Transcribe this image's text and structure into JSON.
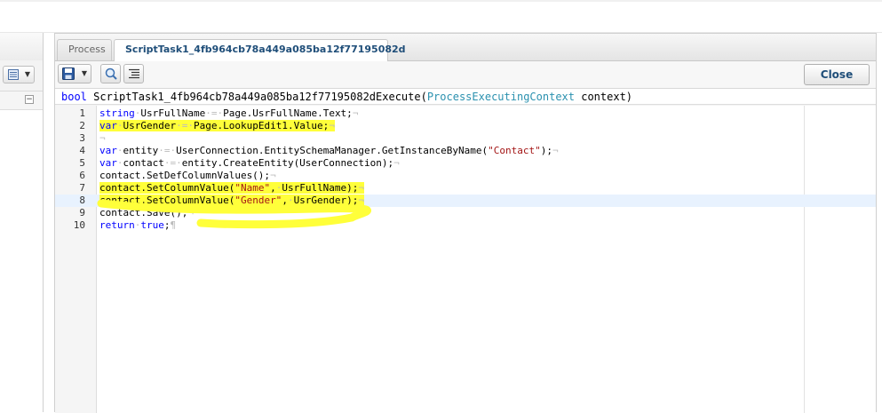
{
  "tabs": [
    {
      "label": "Process",
      "active": false
    },
    {
      "label": "ScriptTask1_4fb964cb78a449a085ba12f77195082d",
      "active": true
    }
  ],
  "toolbar": {
    "close_label": "Close",
    "icons": [
      "save-icon",
      "search-icon",
      "format-code-icon"
    ]
  },
  "signature": {
    "return_type": "bool",
    "method": "ScriptTask1_4fb964cb78a449a085ba12f77195082dExecute(",
    "param_type": "ProcessExecutingContext",
    "param_rest": " context)"
  },
  "editor": {
    "current_line": 8,
    "highlight_color": "#ffff3a",
    "line_numbers": [
      "1",
      "2",
      "3",
      "4",
      "5",
      "6",
      "7",
      "8",
      "9",
      "10"
    ],
    "lines": [
      [
        {
          "t": "string",
          "c": "kw"
        },
        {
          "t": "·",
          "c": "ws"
        },
        {
          "t": "UsrFullName"
        },
        {
          "t": "·=·",
          "c": "ws"
        },
        {
          "t": "Page.UsrFullName.Text;"
        },
        {
          "t": "¬",
          "c": "ws"
        }
      ],
      [
        {
          "t": "var",
          "c": "kw"
        },
        {
          "t": "·",
          "c": "ws"
        },
        {
          "t": "UsrGender"
        },
        {
          "t": "·=·",
          "c": "ws"
        },
        {
          "t": "Page.LookupEdit1.Value;"
        },
        {
          "t": "¬",
          "c": "ws"
        }
      ],
      [
        {
          "t": "¬",
          "c": "ws"
        }
      ],
      [
        {
          "t": "var",
          "c": "kw"
        },
        {
          "t": "·",
          "c": "ws"
        },
        {
          "t": "entity"
        },
        {
          "t": "·=·",
          "c": "ws"
        },
        {
          "t": "UserConnection.EntitySchemaManager.GetInstanceByName("
        },
        {
          "t": "\"Contact\"",
          "c": "str"
        },
        {
          "t": ");"
        },
        {
          "t": "¬",
          "c": "ws"
        }
      ],
      [
        {
          "t": "var",
          "c": "kw"
        },
        {
          "t": "·",
          "c": "ws"
        },
        {
          "t": "contact"
        },
        {
          "t": "·=·",
          "c": "ws"
        },
        {
          "t": "entity.CreateEntity(UserConnection);"
        },
        {
          "t": "¬",
          "c": "ws"
        }
      ],
      [
        {
          "t": "contact.SetDefColumnValues();"
        },
        {
          "t": "¬",
          "c": "ws"
        }
      ],
      [
        {
          "t": "contact.SetColumnValue("
        },
        {
          "t": "\"Name\"",
          "c": "str"
        },
        {
          "t": ","
        },
        {
          "t": "·",
          "c": "ws"
        },
        {
          "t": "UsrFullName);"
        },
        {
          "t": "¬",
          "c": "ws"
        }
      ],
      [
        {
          "t": "contact.SetColumnValue("
        },
        {
          "t": "\"Gender\"",
          "c": "str"
        },
        {
          "t": ","
        },
        {
          "t": "·",
          "c": "ws"
        },
        {
          "t": "UsrGender);"
        },
        {
          "t": "¬",
          "c": "ws"
        }
      ],
      [
        {
          "t": "contact.Save();"
        },
        {
          "t": "¬",
          "c": "ws"
        }
      ],
      [
        {
          "t": "return",
          "c": "kw"
        },
        {
          "t": "·",
          "c": "ws"
        },
        {
          "t": "true",
          "c": "kw"
        },
        {
          "t": ";"
        },
        {
          "t": "¶",
          "c": "ws"
        }
      ]
    ],
    "highlighted_lines": [
      2,
      7,
      8
    ]
  }
}
